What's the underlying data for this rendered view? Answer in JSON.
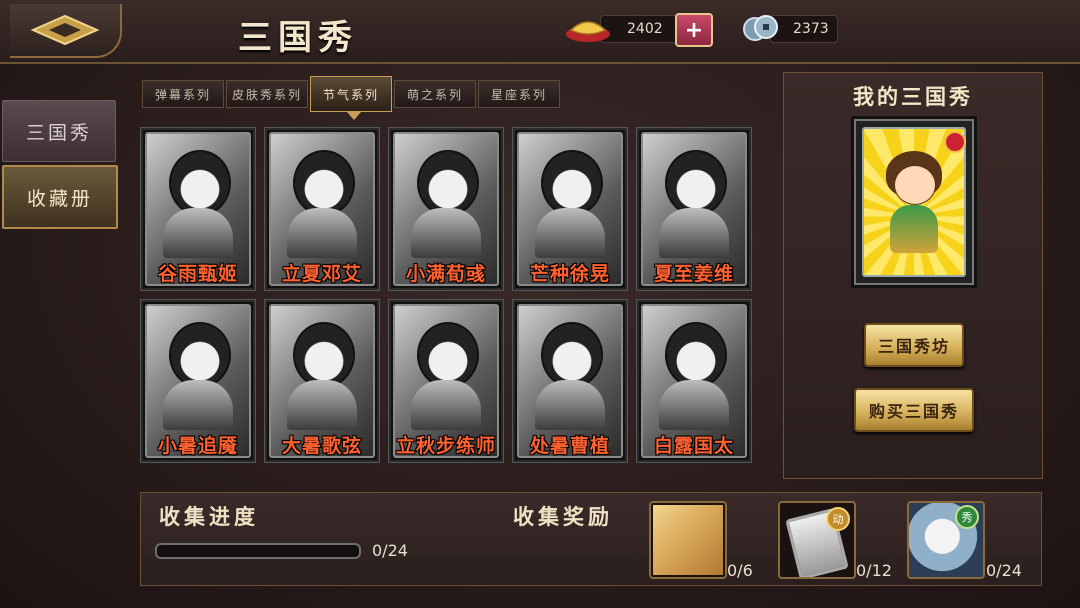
{
  "header": {
    "title": "三国秀",
    "gold": "2402",
    "coins": "2373",
    "add_label": "+"
  },
  "sidebar": {
    "items": [
      {
        "label": "三国秀"
      },
      {
        "label": "收藏册"
      }
    ]
  },
  "series_tabs": [
    {
      "label": "弹幕系列"
    },
    {
      "label": "皮肤秀系列"
    },
    {
      "label": "节气系列",
      "selected": true
    },
    {
      "label": "萌之系列"
    },
    {
      "label": "星座系列"
    }
  ],
  "cards": [
    {
      "name": "谷雨甄姬"
    },
    {
      "name": "立夏邓艾"
    },
    {
      "name": "小满荀彧"
    },
    {
      "name": "芒种徐晃"
    },
    {
      "name": "夏至姜维"
    },
    {
      "name": "小暑追魇"
    },
    {
      "name": "大暑歌弦"
    },
    {
      "name": "立秋步练师"
    },
    {
      "name": "处暑曹植"
    },
    {
      "name": "白露国太"
    }
  ],
  "my_panel": {
    "title": "我的三国秀",
    "shop_button": "三国秀坊",
    "buy_button": "购买三国秀"
  },
  "collection": {
    "progress_label": "收集进度",
    "progress_text": "0/24",
    "progress_fraction": 0.0,
    "reward_label": "收集奖励",
    "rewards": [
      {
        "count": "0/6"
      },
      {
        "count": "0/12",
        "tag": "动"
      },
      {
        "count": "0/24",
        "tag": "秀"
      }
    ]
  }
}
